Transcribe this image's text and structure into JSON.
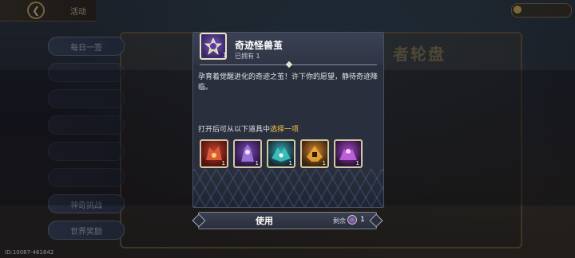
{
  "top": {
    "back_label": "活动"
  },
  "side_tabs": [
    "每日一签",
    "",
    "",
    "",
    "",
    "",
    "",
    "神奇挑战",
    "世界奖励"
  ],
  "bg_title": "者轮盘",
  "footer_id": "ID:10087-461642",
  "item": {
    "name": "奇迹怪兽茧",
    "owned": "已拥有 1",
    "count": "1",
    "icon": "monster-cocoon-icon",
    "description": "孕育着觉醒进化的奇迹之茧！许下你的愿望，静待奇迹降临。"
  },
  "choose": {
    "prefix": "打开后可从以下道具中",
    "highlight": "选择一项"
  },
  "options": [
    {
      "icon": "red-beast-icon",
      "qty": "1"
    },
    {
      "icon": "purple-knight-icon",
      "qty": "1"
    },
    {
      "icon": "teal-dragon-icon",
      "qty": "1"
    },
    {
      "icon": "gold-warrior-icon",
      "qty": "1"
    },
    {
      "icon": "violet-wyvern-icon",
      "qty": "1"
    }
  ],
  "use": {
    "label": "使用",
    "remain_label": "剩余",
    "remain_value": "1"
  },
  "colors": {
    "highlight": "#f2c54a",
    "card_bg": "#2a2f3d"
  }
}
